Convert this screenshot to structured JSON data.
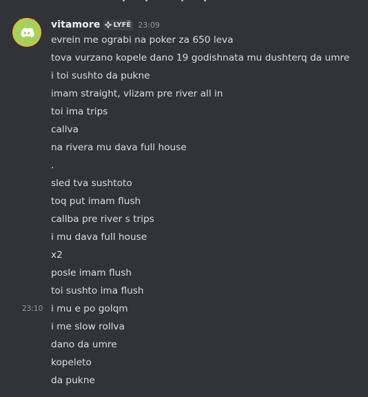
{
  "message_group": {
    "author": "vitamore",
    "clan_tag": "LYFË",
    "timestamp": "23:09",
    "avatar_icon": "discord-logo-icon",
    "clan_icon": "clan-badge-icon",
    "colors": {
      "background": "#313338",
      "avatar_bg": "#a6d05b",
      "avatar_ring": "#f0b232",
      "username": "#f2f3f5",
      "text": "#dbdee1",
      "muted": "#949ba4"
    },
    "messages": [
      {
        "text": "evrein me ograbi na poker za 650 leva",
        "time": ""
      },
      {
        "text": "tova vurzano kopele dano 19 godishnata mu dushterq da umre",
        "time": ""
      },
      {
        "text": "i toi sushto da pukne",
        "time": ""
      },
      {
        "text": "imam straight, vlizam pre river all in",
        "time": ""
      },
      {
        "text": "toi ima trips",
        "time": ""
      },
      {
        "text": "callva",
        "time": ""
      },
      {
        "text": "na rivera mu dava full house",
        "time": ""
      },
      {
        "text": ".",
        "time": ""
      },
      {
        "text": "sled tva sushtoto",
        "time": ""
      },
      {
        "text": "toq put imam flush",
        "time": ""
      },
      {
        "text": "callba pre river s trips",
        "time": ""
      },
      {
        "text": "i mu dava full house",
        "time": ""
      },
      {
        "text": "x2",
        "time": ""
      },
      {
        "text": "posle imam flush",
        "time": ""
      },
      {
        "text": "toi sushto ima flush",
        "time": ""
      },
      {
        "text": "i mu e po golqm",
        "time": "23:10"
      },
      {
        "text": "i me slow rollva",
        "time": ""
      },
      {
        "text": "dano da umre",
        "time": ""
      },
      {
        "text": "kopeleto",
        "time": ""
      },
      {
        "text": "da pukne",
        "time": ""
      }
    ]
  }
}
